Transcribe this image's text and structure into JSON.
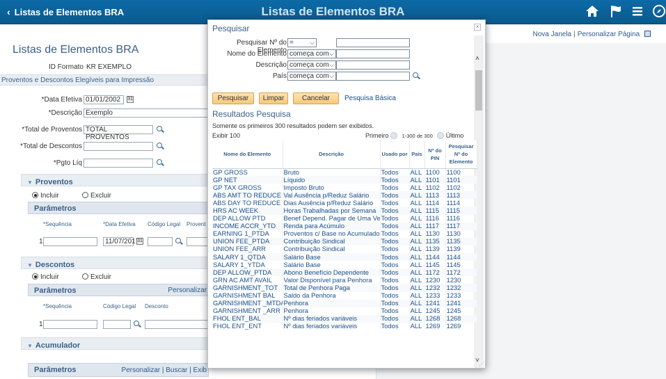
{
  "header": {
    "back_label": "Listas de Elementos BRA",
    "title": "Listas de Elementos BRA",
    "icons": [
      "home-icon",
      "flag-icon",
      "menu-icon",
      "compass-icon"
    ]
  },
  "page": {
    "links": {
      "new_window": "Nova Janela",
      "personalize": "Personalizar Página"
    },
    "title": "Listas de Elementos BRA",
    "format_label": "ID Formato",
    "format_value": "KR EXEMPLO",
    "group_label": "Proventos e Descontos Elegíveis para Impressão",
    "eff_date_label": "*Data Efetiva",
    "eff_date_value": "01/01/2002",
    "desc_label": "*Descrição",
    "desc_value": "Exemplo",
    "total_earn_label": "*Total de Proventos",
    "total_earn_value": "TOTAL PROVENTOS",
    "total_ded_label": "*Total de Descontos",
    "net_pay_label": "*Pgto Líq",
    "earnings": {
      "title": "Proventos",
      "include": "Incluir",
      "exclude": "Excluir",
      "params": "Parâmetros",
      "cols": [
        "*Sequência",
        "*Data Efetiva",
        "Código Legal",
        "Provent"
      ],
      "row_seq": "1",
      "row_date": "11/07/2017"
    },
    "deductions": {
      "title": "Descontos",
      "include": "Incluir",
      "exclude": "Excluir",
      "params": "Parâmetros",
      "personalize": "Personalizar",
      "cols": [
        "*Sequência",
        "Código Legal",
        "Desconto"
      ],
      "row_seq": "1"
    },
    "accumulator": {
      "title": "Acumulador",
      "params": "Parâmetros",
      "links": "Personalizar | Buscar | Exib"
    }
  },
  "modal": {
    "title": "Pesquisar",
    "close": "×",
    "fields": [
      {
        "label": "Pesquisar Nº do Elemento",
        "op": "="
      },
      {
        "label": "Nome do Elemento",
        "op": "começa com"
      },
      {
        "label": "Descrição",
        "op": "começa com"
      },
      {
        "label": "País",
        "op": "começa com"
      }
    ],
    "buttons": {
      "search": "Pesquisar",
      "clear": "Limpar",
      "cancel": "Cancelar"
    },
    "basic_link": "Pesquisa Básica",
    "results_title": "Resultados Pesquisa",
    "results_note": "Somente os primeiros 300 resultados podem ser exibidos.",
    "show": "Exibir 100",
    "first": "Primeiro",
    "range": "1-300 de 300",
    "last": "Último",
    "columns": [
      "Nome do Elemento",
      "Descrição",
      "Usado por",
      "País",
      "Nº do PIN",
      "Pesquisar Nº do Elemento"
    ],
    "rows": [
      [
        "GP GROSS",
        "Bruto",
        "Todos",
        "ALL",
        "1100",
        "1100"
      ],
      [
        "GP NET",
        "Líquido",
        "Todos",
        "ALL",
        "1101",
        "1101"
      ],
      [
        "GP TAX GROSS",
        "Imposto Bruto",
        "Todos",
        "ALL",
        "1102",
        "1102"
      ],
      [
        "ABS AMT TO REDUCE",
        "Val Ausência p/Reduz Salário",
        "Todos",
        "ALL",
        "1113",
        "1113"
      ],
      [
        "ABS DAY TO REDUCE",
        "Dias Ausência p/Reduz Salário",
        "Todos",
        "ALL",
        "1114",
        "1114"
      ],
      [
        "HRS AC WEEK",
        "Horas Trabalhadas por Semana",
        "Todos",
        "ALL",
        "1115",
        "1115"
      ],
      [
        "DEP ALLOW PTD",
        "Benef Depend. Pagar de Uma Vez",
        "Todos",
        "ALL",
        "1116",
        "1116"
      ],
      [
        "INCOME ACCR_YTD",
        "Renda para Acúmulo",
        "Todos",
        "ALL",
        "1117",
        "1117"
      ],
      [
        "EARNING 1_PTDA",
        "Proventos c/ Base no Acumulado",
        "Todos",
        "ALL",
        "1130",
        "1130"
      ],
      [
        "UNION FEE_PTDA",
        "Contribuição Sindical",
        "Todos",
        "ALL",
        "1135",
        "1135"
      ],
      [
        "UNION FEE_ARR",
        "Contribuição Sindical",
        "Todos",
        "ALL",
        "1139",
        "1139"
      ],
      [
        "SALARY 1_QTDA",
        "Salário Base",
        "Todos",
        "ALL",
        "1144",
        "1144"
      ],
      [
        "SALARY 1_YTDA",
        "Salário Base",
        "Todos",
        "ALL",
        "1145",
        "1145"
      ],
      [
        "DEP ALLOW_PTDA",
        "Abono Benefício Dependente",
        "Todos",
        "ALL",
        "1172",
        "1172"
      ],
      [
        "GRN AC AMT AVAIL",
        "Valor Disponível para Penhora",
        "Todos",
        "ALL",
        "1230",
        "1230"
      ],
      [
        "GARNISHMENT_TOT",
        "Total de Penhora Paga",
        "Todos",
        "ALL",
        "1232",
        "1232"
      ],
      [
        "GARNISHMENT BAL",
        "Saldo da Penhora",
        "Todos",
        "ALL",
        "1233",
        "1233"
      ],
      [
        "GARNISHMENT _MTDA",
        "Penhora",
        "Todos",
        "ALL",
        "1241",
        "1241"
      ],
      [
        "GARNISHMENT _ARR",
        "Penhora",
        "Todos",
        "ALL",
        "1245",
        "1245"
      ],
      [
        "FHOL ENT_BAL",
        "Nº dias feriados variáveis",
        "Todos",
        "ALL",
        "1268",
        "1268"
      ],
      [
        "FHOL ENT_ENT",
        "Nº dias feriados variáveis",
        "Todos",
        "ALL",
        "1269",
        "1269"
      ]
    ]
  }
}
